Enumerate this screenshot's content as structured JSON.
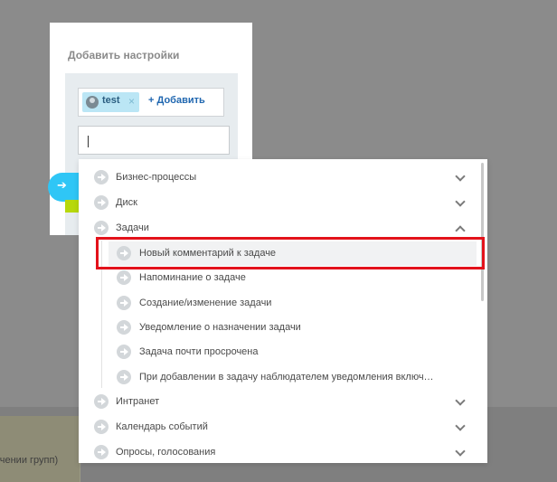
{
  "settings": {
    "title": "Добавить настройки",
    "tag_label": "test",
    "tag_close": "×",
    "add_label": "+ Добавить",
    "search_value": ""
  },
  "background": {
    "partial_text": "ечении групп)"
  },
  "dropdown": {
    "categories": [
      {
        "label": "Бизнес-процессы",
        "expanded": false
      },
      {
        "label": "Диск",
        "expanded": false
      },
      {
        "label": "Задачи",
        "expanded": true
      },
      {
        "label": "Интранет",
        "expanded": false
      },
      {
        "label": "Календарь событий",
        "expanded": false
      },
      {
        "label": "Опросы, голосования",
        "expanded": false
      }
    ],
    "task_items": [
      {
        "label": "Новый комментарий к задаче",
        "highlighted": true
      },
      {
        "label": "Напоминание о задаче"
      },
      {
        "label": "Создание/изменение задачи"
      },
      {
        "label": "Уведомление о назначении задачи"
      },
      {
        "label": "Задача почти просрочена"
      },
      {
        "label": "При добавлении в задачу наблюдателем уведомления включ…"
      }
    ]
  },
  "colors": {
    "accent_blue": "#2fc6f6",
    "highlight_red": "#e3121b",
    "tag_bg": "#bbe6f5"
  }
}
